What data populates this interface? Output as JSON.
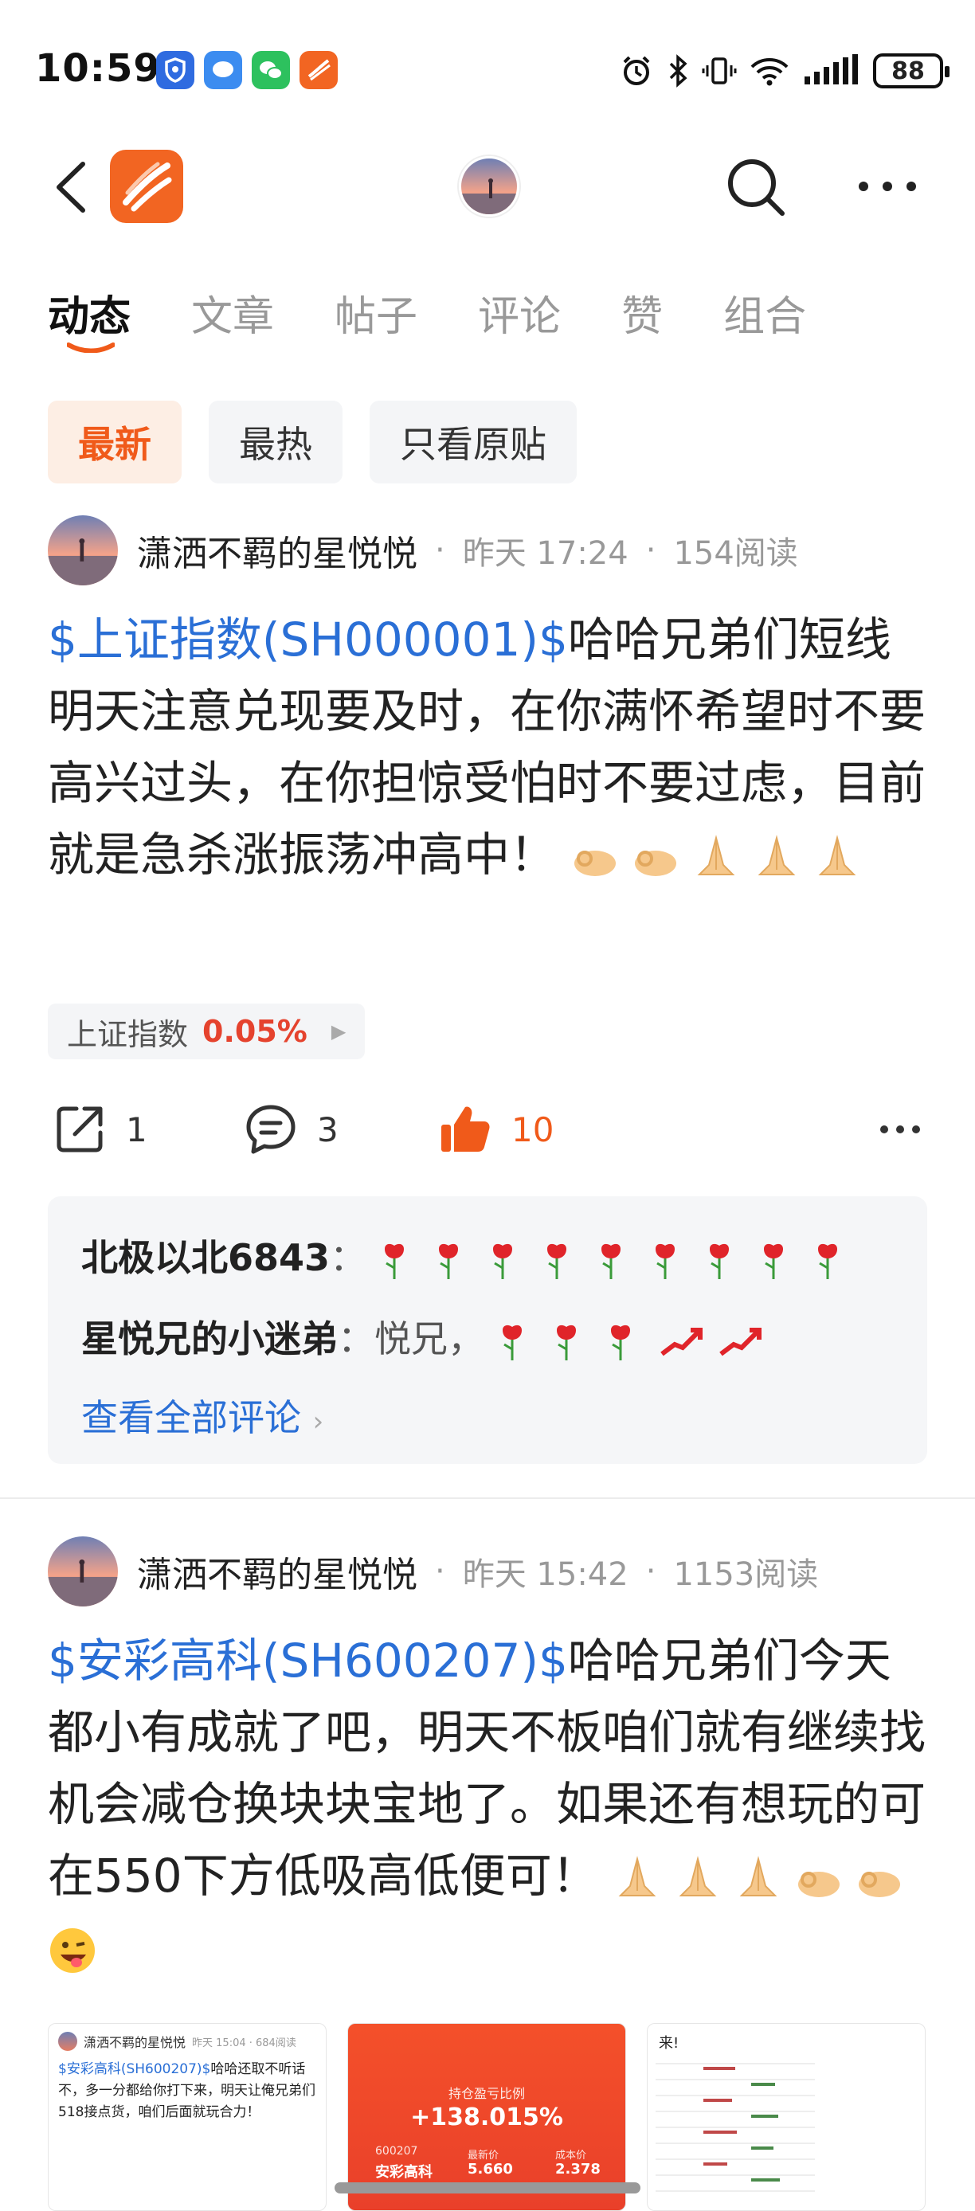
{
  "status": {
    "time": "10:59",
    "battery": "88"
  },
  "tabs": [
    "动态",
    "文章",
    "帖子",
    "评论",
    "赞",
    "组合"
  ],
  "filters": [
    "最新",
    "最热",
    "只看原贴"
  ],
  "posts": [
    {
      "author": "潇洒不羁的星悦悦",
      "time": "昨天 17:24",
      "reads": "154阅读",
      "stock": "$上证指数(SH000001)$",
      "text": "哈哈兄弟们短线明天注意兑现要及时，在你满怀希望时不要高兴过头，在你担惊受怕时不要过虑，目前就是急杀涨振荡冲高中！",
      "quote": {
        "name": "上证指数",
        "change": "0.05%"
      },
      "shares": "1",
      "comments_count": "3",
      "likes": "10",
      "comments": [
        {
          "user": "北极以北6843",
          "text": "："
        },
        {
          "user": "星悦兄的小迷弟",
          "text": "：悦兄，"
        }
      ],
      "see_all": "查看全部评论"
    },
    {
      "author": "潇洒不羁的星悦悦",
      "time": "昨天 15:42",
      "reads": "1153阅读",
      "stock": "$安彩高科(SH600207)$",
      "text": "哈哈兄弟们今天都小有成就了吧，明天不板咱们就有继续找机会减仓换块块宝地了。如果还有想玩的可在550下方低吸高低便可！"
    }
  ],
  "thumbs": {
    "t1": {
      "author": "潇洒不羁的星悦悦",
      "meta": "昨天 15:04 · 684阅读",
      "stock": "$安彩高科(SH600207)$",
      "text": "哈哈还取不听话不，多一分都给你打下来，明天让俺兄弟们518接点货，咱们后面就玩合力！"
    },
    "t2": {
      "label": "持仓盈亏比例",
      "pct": "+138.015%",
      "code": "600207",
      "name": "安彩高科",
      "latest_label": "最新价",
      "latest": "5.660",
      "cost_label": "成本价",
      "cost": "2.378"
    },
    "t3": {
      "text": "来!"
    }
  }
}
